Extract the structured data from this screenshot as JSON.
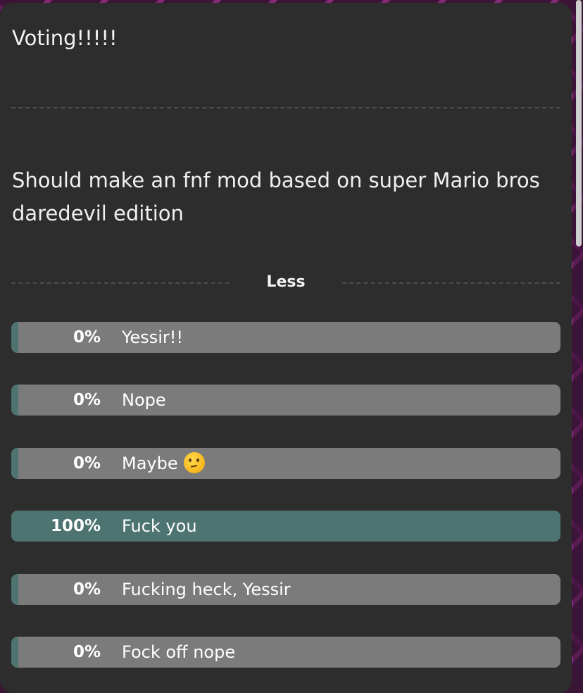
{
  "poll": {
    "title": "Voting!!!!!",
    "question": "Should make an fnf mod based on super Mario bros daredevil edition",
    "toggle_label": "Less",
    "options": [
      {
        "percent": "0%",
        "fraction": 0,
        "label": "Yessir!!",
        "emoji": ""
      },
      {
        "percent": "0%",
        "fraction": 0,
        "label": "Nope",
        "emoji": ""
      },
      {
        "percent": "0%",
        "fraction": 0,
        "label": "Maybe",
        "emoji": "thinking-face-emoji"
      },
      {
        "percent": "100%",
        "fraction": 1,
        "label": "Fuck you",
        "emoji": ""
      },
      {
        "percent": "0%",
        "fraction": 0,
        "label": "Fucking heck, Yessir",
        "emoji": ""
      },
      {
        "percent": "0%",
        "fraction": 0,
        "label": "Fock off nope",
        "emoji": ""
      }
    ]
  },
  "colors": {
    "card_background": "#2d2d2d",
    "option_background": "#7b7b7b",
    "option_fill": "#4d7470",
    "page_background": "#3b1436"
  }
}
